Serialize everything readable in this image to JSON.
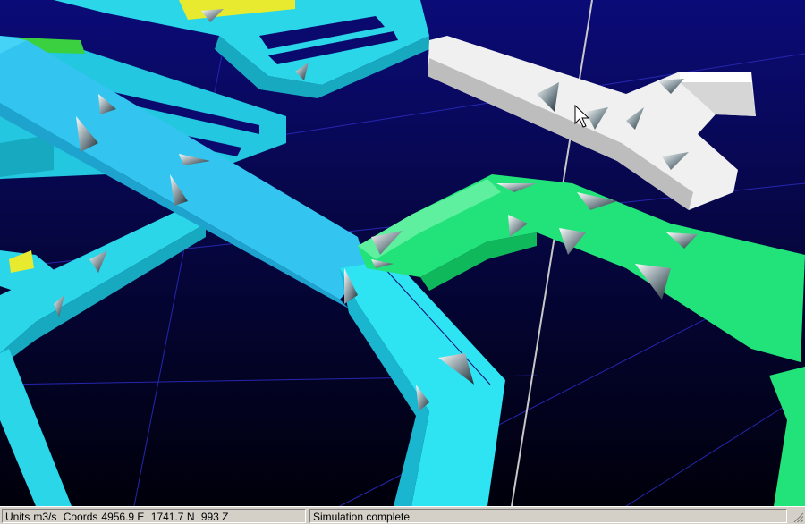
{
  "viewport": {
    "colors": {
      "background_top": "#0a0a6e",
      "background_bottom": "#000008",
      "grid_line": "#2a2ab8",
      "cyan_face": "#35e6f2",
      "cyan_side": "#1cc8e0",
      "blue_face": "#35c6f2",
      "green_face": "#1fe07a",
      "white_face": "#f2f2f2",
      "yellow_face": "#e8ea30",
      "axis_line": "#c8c8c8"
    }
  },
  "statusbar": {
    "units_label": "Units",
    "units_value": "m3/s",
    "coords_label": "Coords",
    "coord_e": "4956.9 E",
    "coord_n": "1741.7 N",
    "coord_z": "993 Z",
    "message": "Simulation complete"
  }
}
